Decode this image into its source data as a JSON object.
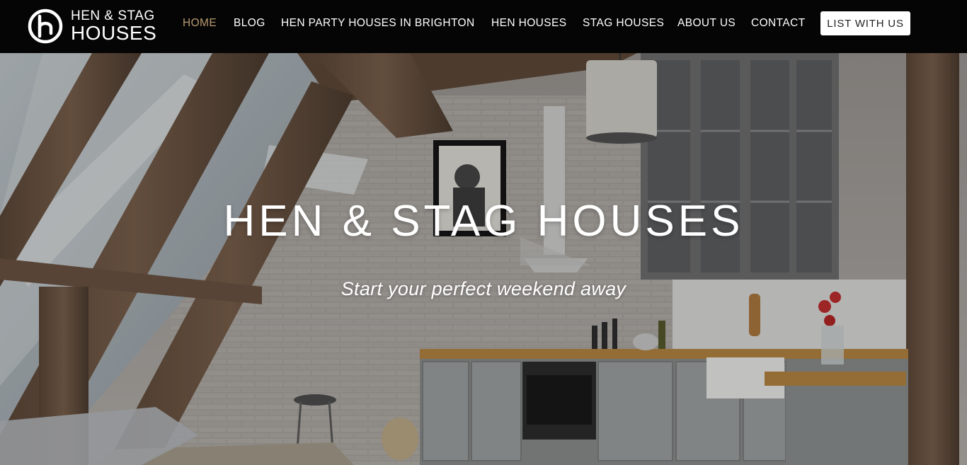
{
  "brand": {
    "line1": "HEN & STAG",
    "line2": "HOUSES",
    "logo_icon": "circled-h-logo-icon"
  },
  "nav": {
    "items": [
      {
        "label": "HOME",
        "active": true
      },
      {
        "label": "BLOG",
        "active": false
      },
      {
        "label": "HEN PARTY HOUSES IN BRIGHTON",
        "active": false
      },
      {
        "label": "HEN HOUSES",
        "active": false
      },
      {
        "label": "STAG HOUSES",
        "active": false
      },
      {
        "label": "ABOUT US",
        "active": false
      },
      {
        "label": "CONTACT",
        "active": false
      }
    ],
    "cta_label": "LIST WITH US"
  },
  "hero": {
    "title": "HEN & STAG HOUSES",
    "subtitle": "Start your perfect weekend away",
    "background_description_icon": "attic-kitchen-photo"
  },
  "colors": {
    "header_bg": "#050505",
    "active_nav": "#b89a6e",
    "text": "#ffffff"
  }
}
